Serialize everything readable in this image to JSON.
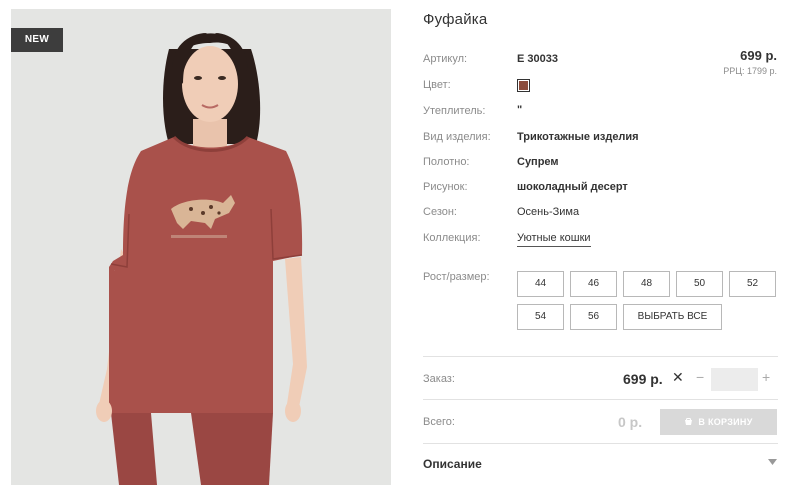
{
  "product": {
    "badge": "NEW",
    "title": "Фуфайка",
    "price": "699 р.",
    "rrp": "РРЦ: 1799 р."
  },
  "attributes": {
    "article": {
      "label": "Артикул:",
      "value": "Е 30033"
    },
    "color": {
      "label": "Цвет:",
      "swatch": "#8b4b3b"
    },
    "insulation": {
      "label": "Утеплитель:",
      "value": "\""
    },
    "type": {
      "label": "Вид изделия:",
      "value": "Трикотажные изделия"
    },
    "fabric": {
      "label": "Полотно:",
      "value": "Супрем"
    },
    "pattern": {
      "label": "Рисунок:",
      "value": "шоколадный десерт"
    },
    "season": {
      "label": "Сезон:",
      "value": "Осень-Зима"
    },
    "collection": {
      "label": "Коллекция:",
      "value": "Уютные кошки"
    }
  },
  "sizes": {
    "label": "Рост/размер:",
    "options": [
      "44",
      "46",
      "48",
      "50",
      "52",
      "54",
      "56"
    ],
    "select_all": "ВЫБРАТЬ ВСЕ"
  },
  "order": {
    "label": "Заказ:",
    "price": "699 р.",
    "times": "✕",
    "minus": "−",
    "plus": "+",
    "quantity": ""
  },
  "total": {
    "label": "Всего:",
    "value": "0 р.",
    "cart_button": "В КОРЗИНУ"
  },
  "description": {
    "label": "Описание"
  },
  "colors": {
    "tshirt": "#a9514b",
    "background": "#e4e5e3",
    "badge": "#3d3d3d",
    "cart_disabled": "#d9d9d9"
  }
}
